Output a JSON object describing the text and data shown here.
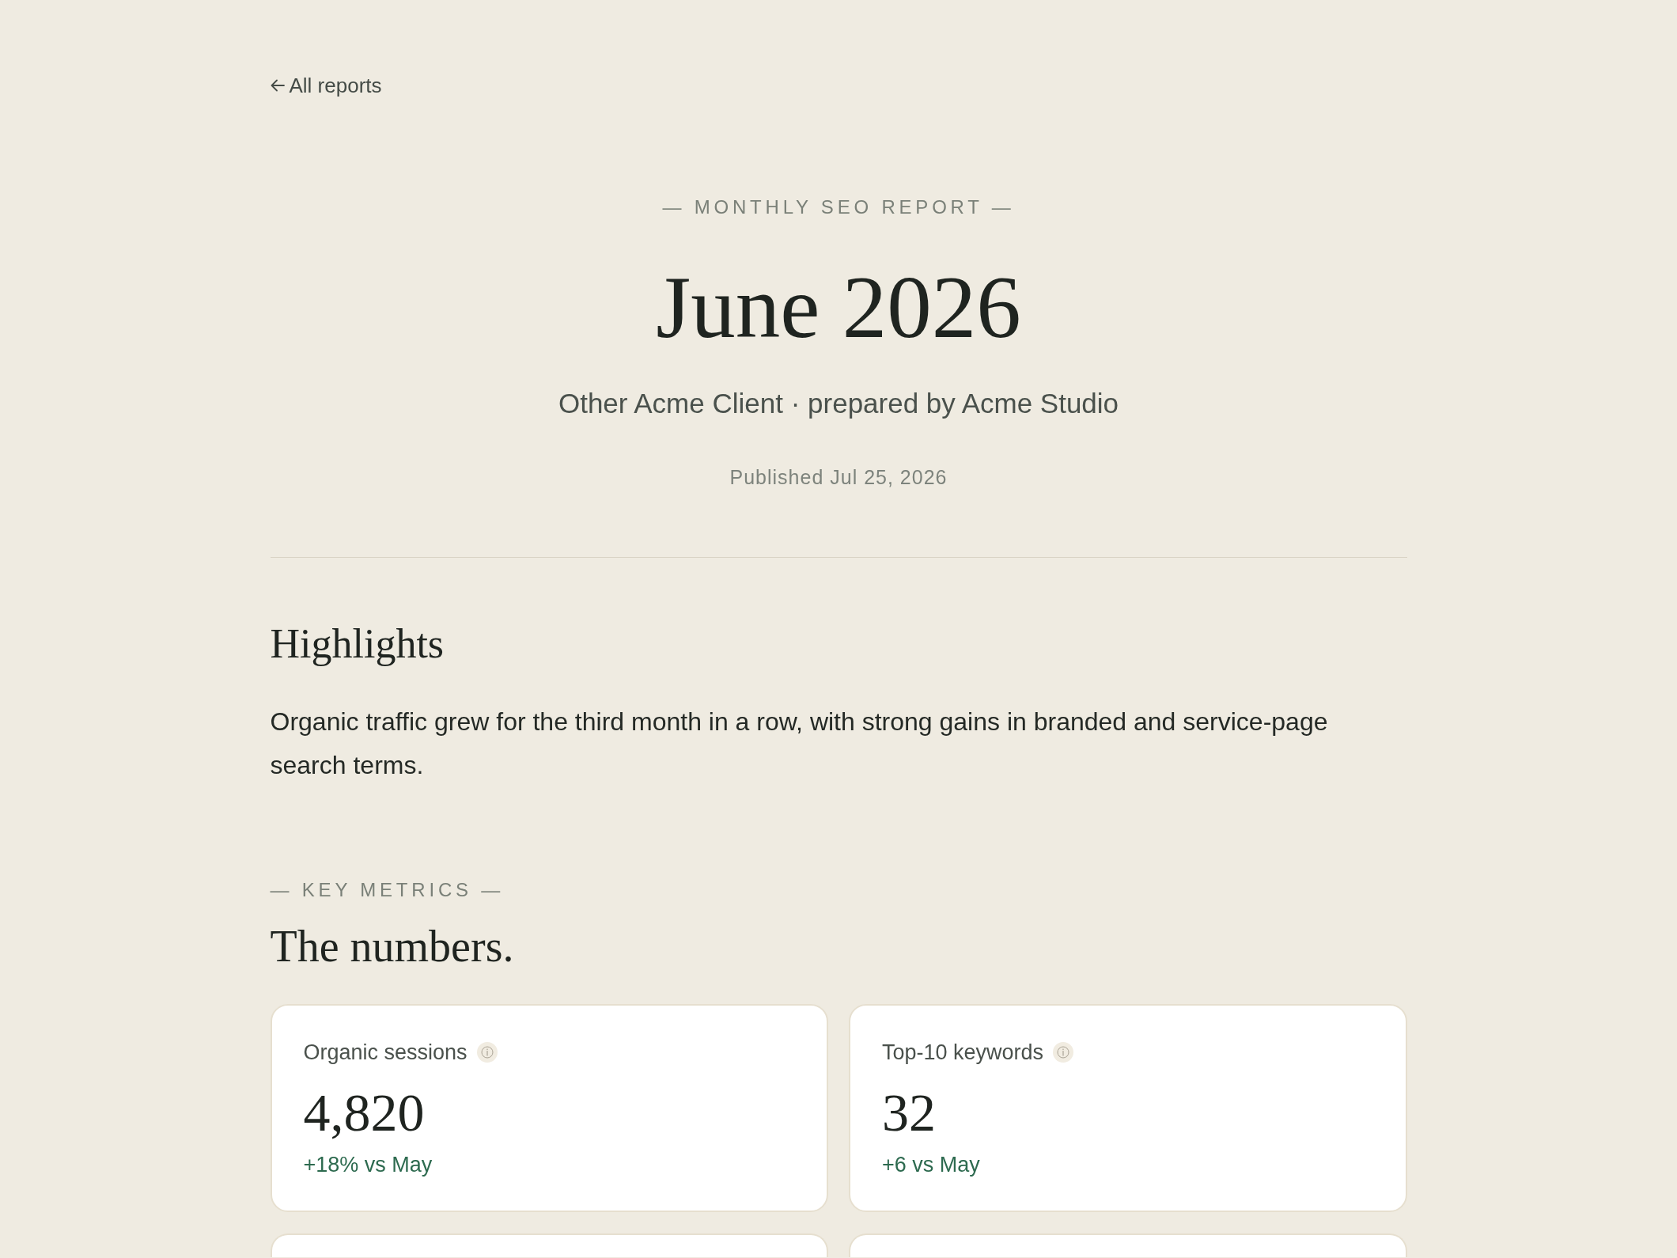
{
  "back_link": {
    "label": "All reports"
  },
  "header": {
    "eyebrow": "— MONTHLY SEO REPORT —",
    "title": "June 2026",
    "subtitle": "Other Acme Client · prepared by Acme Studio",
    "published": "Published Jul 25, 2026"
  },
  "highlights": {
    "heading": "Highlights",
    "body": "Organic traffic grew for the third month in a row, with strong gains in branded and service-page search terms."
  },
  "key_metrics": {
    "eyebrow": "— KEY METRICS —",
    "heading": "The numbers.",
    "cards": [
      {
        "kind": "stat",
        "label": "Organic sessions",
        "value": "4,820",
        "change": "+18% vs May"
      },
      {
        "kind": "stat",
        "label": "Top-10 keywords",
        "value": "32",
        "change": "+6 vs May"
      },
      {
        "kind": "cut_off"
      },
      {
        "kind": "cut_off"
      }
    ]
  }
}
